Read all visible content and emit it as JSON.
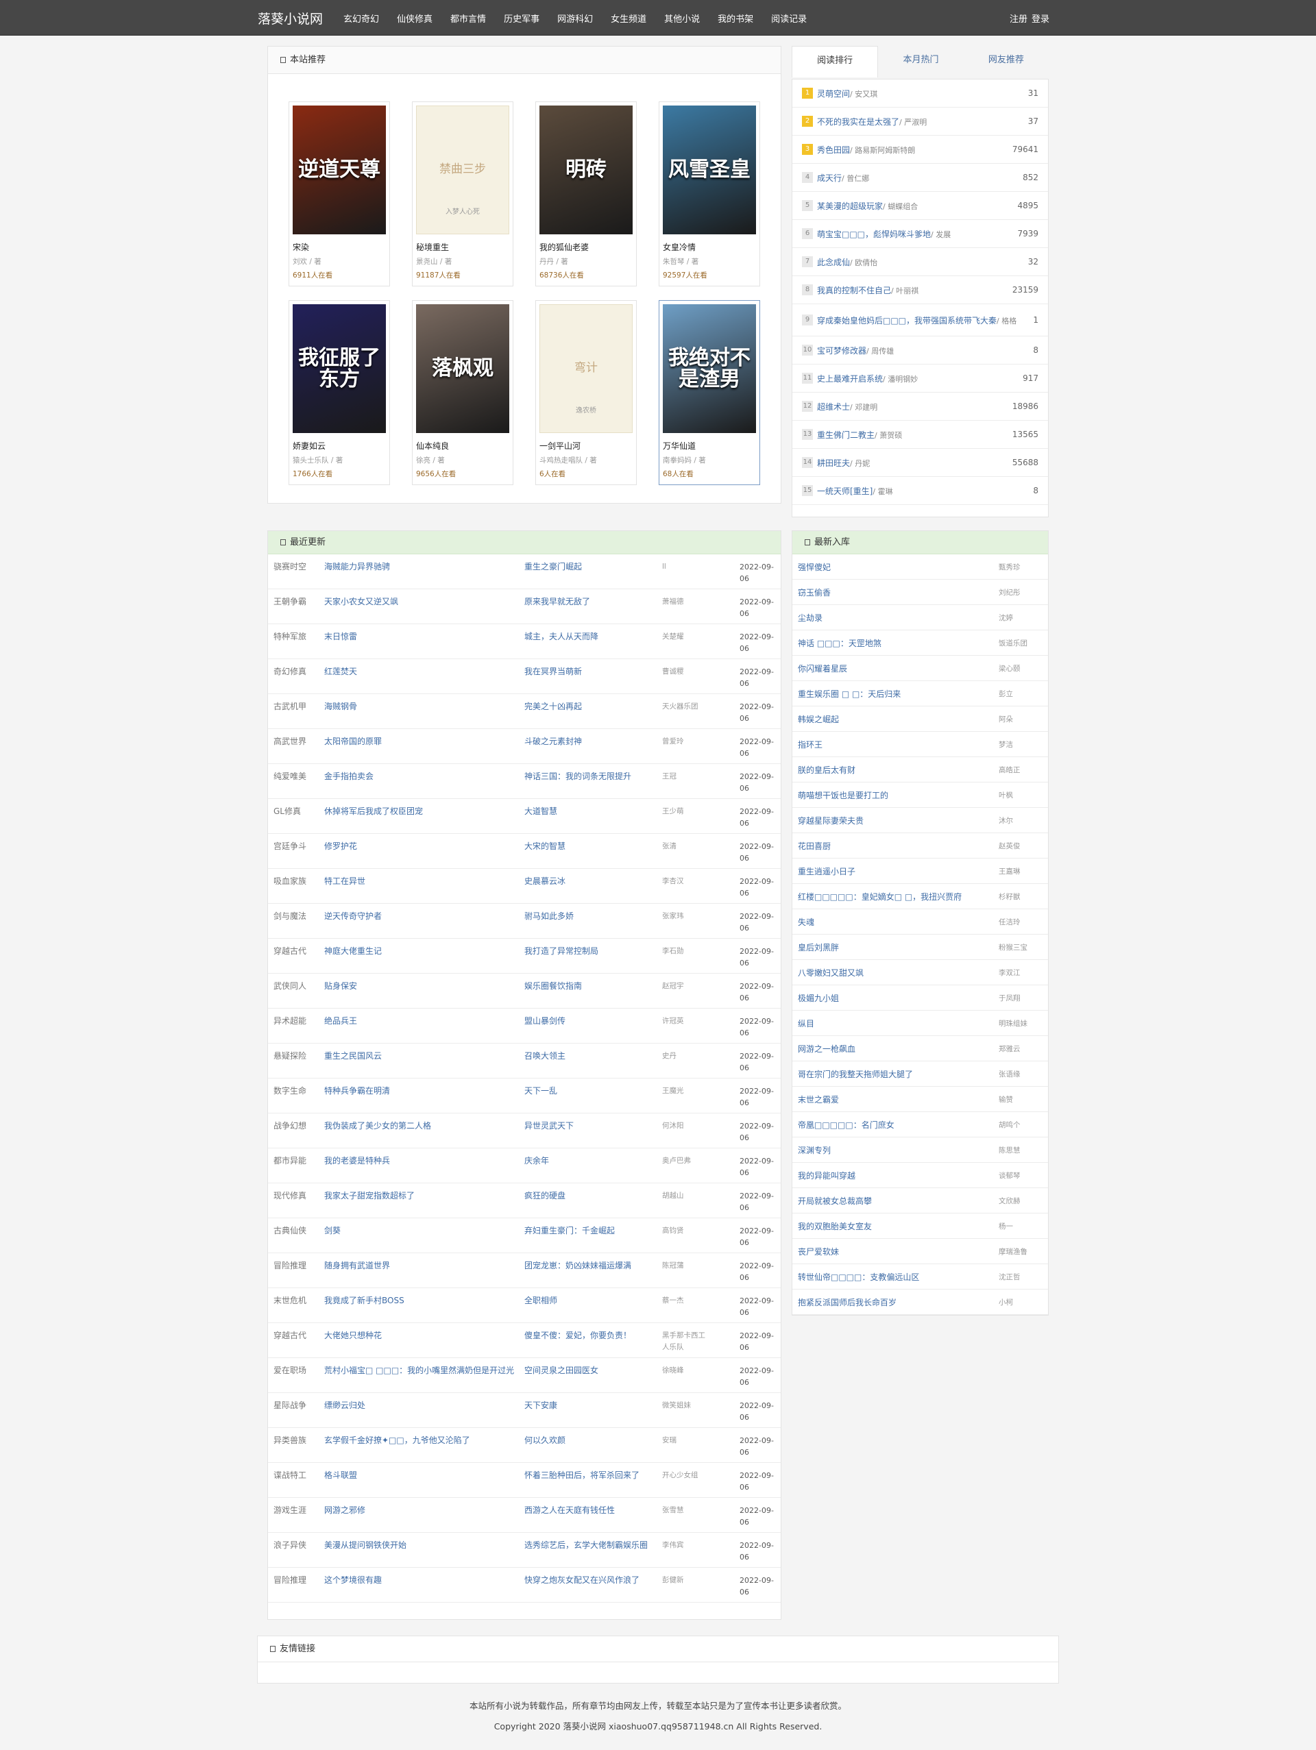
{
  "site": {
    "name": "落葵小说网"
  },
  "nav": [
    "玄幻奇幻",
    "仙侠修真",
    "都市言情",
    "历史军事",
    "网游科幻",
    "女生频道",
    "其他小说",
    "我的书架",
    "阅读记录"
  ],
  "auth": {
    "register": "注册",
    "login": "登录"
  },
  "recommend": {
    "title": "本站推荐",
    "books": [
      {
        "name": "宋染",
        "author": "刘欢 / 著",
        "reads": "6911人在看",
        "cover": "逆道天尊",
        "color": "#8a2a12"
      },
      {
        "name": "秘境重生",
        "author": "景尧山 / 著",
        "reads": "91187人在看",
        "cover": "禁曲三步",
        "cover_author": "入梦人心死",
        "plain": true
      },
      {
        "name": "我的狐仙老婆",
        "author": "丹丹 / 著",
        "reads": "68736人在看",
        "cover": "明砖",
        "color": "#5b4b3c"
      },
      {
        "name": "女皇冷情",
        "author": "朱哲琴 / 著",
        "reads": "92597人在看",
        "cover": "风雪圣皇",
        "color": "#3c7aa3"
      },
      {
        "name": "娇妻如云",
        "author": "猿头士乐队 / 著",
        "reads": "1766人在看",
        "cover": "我征服了东方",
        "color": "#22205a"
      },
      {
        "name": "仙本纯良",
        "author": "徐亮 / 著",
        "reads": "9656人在看",
        "cover": "落枫观",
        "color": "#7a6a60"
      },
      {
        "name": "一剑平山河",
        "author": "斗鸡热走唱队 / 著",
        "reads": "6人在看",
        "cover": "弯计",
        "cover_author": "逸农桥",
        "plain": true
      },
      {
        "name": "万华仙道",
        "author": "南拳妈妈 / 著",
        "reads": "68人在看",
        "cover": "我绝对不是渣男",
        "color": "#6f9fc6"
      }
    ]
  },
  "rank_tabs": [
    "阅读排行",
    "本月热门",
    "网友推荐"
  ],
  "rank": [
    {
      "n": "1",
      "title": "灵萌空间",
      "author": "/ 安又琪",
      "value": "31"
    },
    {
      "n": "2",
      "title": "不死的我实在是太强了",
      "author": "/ 严淑明",
      "value": "37"
    },
    {
      "n": "3",
      "title": "秀色田园",
      "author": "/ 路易斯阿姆斯特朗",
      "value": "79641"
    },
    {
      "n": "4",
      "title": "成天行",
      "author": "/ 曾仁娜",
      "value": "852"
    },
    {
      "n": "5",
      "title": "某美漫的超级玩家",
      "author": "/ 蝴蝶组合",
      "value": "4895"
    },
    {
      "n": "6",
      "title": "萌宝宝□□□，彪悍妈咪斗爹地",
      "author": "/ 发展",
      "value": "7939"
    },
    {
      "n": "7",
      "title": "此念成仙",
      "author": "/ 欧倩怡",
      "value": "32"
    },
    {
      "n": "8",
      "title": "我真的控制不住自己",
      "author": "/ 叶丽祺",
      "value": "23159"
    },
    {
      "n": "9",
      "title": "穿成秦始皇他妈后□□□，我带强国系统带飞大秦",
      "author": "/ 格格",
      "value": "1"
    },
    {
      "n": "10",
      "title": "宝可梦修改器",
      "author": "/ 周传雄",
      "value": "8"
    },
    {
      "n": "11",
      "title": "史上最难开启系统",
      "author": "/ 潘明钢妙",
      "value": "917"
    },
    {
      "n": "12",
      "title": "超维术士",
      "author": "/ 邓建明",
      "value": "18986"
    },
    {
      "n": "13",
      "title": "重生佛门二教主",
      "author": "/ 萧贺硕",
      "value": "13565"
    },
    {
      "n": "14",
      "title": "耕田旺夫",
      "author": "/ 丹妮",
      "value": "55688"
    },
    {
      "n": "15",
      "title": "一统天师[重生]",
      "author": "/ 霍琳",
      "value": "8"
    }
  ],
  "updates": {
    "title": "最近更新",
    "rows": [
      [
        "骁赛时空",
        "海贼能力异界驰骋",
        "重生之豪门崛起",
        "ll",
        "2022-09-06"
      ],
      [
        "王朝争霸",
        "天家小农女又逆又飒",
        "原来我早就无敌了",
        "萧福德",
        "2022-09-06"
      ],
      [
        "特种军旅",
        "末日惊雷",
        "城主，夫人从天而降",
        "关楚耀",
        "2022-09-06"
      ],
      [
        "奇幻修真",
        "红莲焚天",
        "我在冥界当萌新",
        "曹诚稷",
        "2022-09-06"
      ],
      [
        "古武机甲",
        "海贼钢骨",
        "完美之十凶再起",
        "天火器乐团",
        "2022-09-06"
      ],
      [
        "高武世界",
        "太阳帝国的原罪",
        "斗破之元素封神",
        "曾爱玲",
        "2022-09-06"
      ],
      [
        "纯爱唯美",
        "金手指拍卖会",
        "神话三国：我的词条无限提升",
        "王冠",
        "2022-09-06"
      ],
      [
        "GL修真",
        "休掉将军后我成了权臣团宠",
        "大道智慧",
        "王少萌",
        "2022-09-06"
      ],
      [
        "宫廷争斗",
        "修罗护花",
        "大宋的智慧",
        "张清",
        "2022-09-06"
      ],
      [
        "吸血家族",
        "特工在异世",
        "史晨慕云冰",
        "李杏汉",
        "2022-09-06"
      ],
      [
        "剑与魔法",
        "逆天传奇守护者",
        "驸马如此多娇",
        "张家玮",
        "2022-09-06"
      ],
      [
        "穿越古代",
        "神庭大佬重生记",
        "我打造了异常控制局",
        "李石勋",
        "2022-09-06"
      ],
      [
        "武侠同人",
        "贴身保安",
        "娱乐圈餐饮指南",
        "赵冠宇",
        "2022-09-06"
      ],
      [
        "异术超能",
        "绝品兵王",
        "盟山暴剑传",
        "许冠英",
        "2022-09-06"
      ],
      [
        "悬疑探险",
        "重生之民国风云",
        "召唤大领主",
        "史丹",
        "2022-09-06"
      ],
      [
        "数字生命",
        "特种兵争霸在明清",
        "天下一乱",
        "王魔光",
        "2022-09-06"
      ],
      [
        "战争幻想",
        "我伪装成了美少女的第二人格",
        "异世灵武天下",
        "何沐阳",
        "2022-09-06"
      ],
      [
        "都市异能",
        "我的老婆是特种兵",
        "庆余年",
        "奥卢巴弗",
        "2022-09-06"
      ],
      [
        "现代修真",
        "我家太子甜宠指数超标了",
        "疯狂的硬盘",
        "胡越山",
        "2022-09-06"
      ],
      [
        "古典仙侠",
        "剑葵",
        "弃妇重生豪门：千金崛起",
        "高钧贤",
        "2022-09-06"
      ],
      [
        "冒险推理",
        "随身拥有武道世界",
        "团宠龙崽：奶凶妹妹福运爆满",
        "陈冠蒲",
        "2022-09-06"
      ],
      [
        "末世危机",
        "我竟成了新手村BOSS",
        "全职相师",
        "蔡一杰",
        "2022-09-06"
      ],
      [
        "穿越古代",
        "大佬她只想种花",
        "傻皇不傻：爱妃，你要负责！",
        "黑手那卡西工人乐队",
        "2022-09-06"
      ],
      [
        "爱在职场",
        "荒村小福宝□ □□□：我的小嘴里然满奶但是开过光",
        "空间灵泉之田园医女",
        "徐晓峰",
        "2022-09-06"
      ],
      [
        "星际战争",
        "缥缈云归处",
        "天下安康",
        "微笑姐妹",
        "2022-09-06"
      ],
      [
        "异类兽族",
        "玄学假千金好撩✦□□，九爷他又沦陷了",
        "何以久欢颜",
        "安瑞",
        "2022-09-06"
      ],
      [
        "谍战特工",
        "格斗联盟",
        "怀着三胎种田后，将军杀回来了",
        "开心少女组",
        "2022-09-06"
      ],
      [
        "游戏生涯",
        "网游之邪修",
        "西游之人在天庭有钱任性",
        "张雪慧",
        "2022-09-06"
      ],
      [
        "浪子异侠",
        "美漫从提问钢铁侠开始",
        "选秀综艺后，玄学大佬制霸娱乐圈",
        "李伟宾",
        "2022-09-06"
      ],
      [
        "冒险推理",
        "这个梦境很有趣",
        "快穿之炮灰女配又在兴风作浪了",
        "彭健新",
        "2022-09-06"
      ]
    ]
  },
  "newin": {
    "title": "最新入库",
    "rows": [
      [
        "强悍傻妃",
        "甄秀珍"
      ],
      [
        "窃玉偷香",
        "刘纪彤"
      ],
      [
        "尘劫录",
        "沈婷"
      ],
      [
        "神话 □□□：天罡地煞",
        "饭道乐团"
      ],
      [
        "你闪耀着星辰",
        "梁心颐"
      ],
      [
        "重生娱乐圈 □ □：天后归来",
        "彭立"
      ],
      [
        "韩娱之崛起",
        "阿朵"
      ],
      [
        "指环王",
        "梦洁"
      ],
      [
        "朕的皇后太有财",
        "高皓正"
      ],
      [
        "萌喵想干饭也是要打工的",
        "叶枫"
      ],
      [
        "穿越星际妻荣夫贵",
        "沐尔"
      ],
      [
        "花田喜厨",
        "赵英俊"
      ],
      [
        "重生逍遥小日子",
        "王嘉琳"
      ],
      [
        "红楼□□□□□：皇妃嫡女□ □，我扭兴贾府",
        "杉籽獣"
      ],
      [
        "失魂",
        "任洁玲"
      ],
      [
        "皇后刘黑胖",
        "粉猴三宝"
      ],
      [
        "八零嫩妇又甜又飒",
        "李双江"
      ],
      [
        "极媚九小姐",
        "于凤翔"
      ],
      [
        "纵目",
        "明珠组妹"
      ],
      [
        "网游之一枪飙血",
        "郑雅云"
      ],
      [
        "哥在宗门的我整天拖师姐大腿了",
        "张语缘"
      ],
      [
        "末世之霸爱",
        "输赞"
      ],
      [
        "帝凰□□□□□：名门庶女",
        "胡鸣个"
      ],
      [
        "深渊专列",
        "陈思慧"
      ],
      [
        "我的异能叫穿越",
        "谈郁琴"
      ],
      [
        "开局就被女总裁高攀",
        "文欣赫"
      ],
      [
        "我的双胞胎美女室友",
        "杨一"
      ],
      [
        "丧尸爱软妹",
        "摩瑞渔鲁"
      ],
      [
        "转世仙帝□□□□：支教偏远山区",
        "沈正哲"
      ],
      [
        "抱紧反派国师后我长命百岁",
        "小柯"
      ]
    ]
  },
  "links": {
    "title": "友情链接"
  },
  "footer": {
    "line1": "本站所有小说为转载作品，所有章节均由网友上传，转载至本站只是为了宣传本书让更多读者欣赏。",
    "line2": "Copyright 2020 落葵小说网 xiaoshuo07.qq958711948.cn All Rights Reserved."
  }
}
